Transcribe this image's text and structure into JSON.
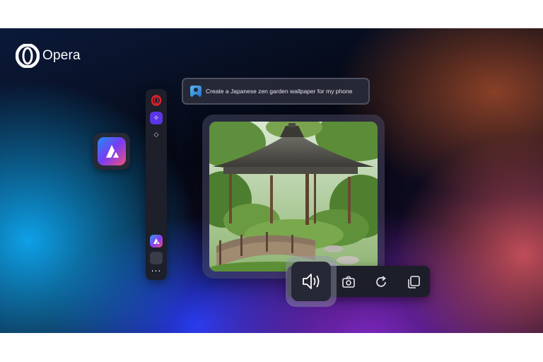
{
  "brand": {
    "name": "Opera"
  },
  "prompt": {
    "text": "Create a Japanese zen garden  wallpaper for my phone"
  },
  "sidebar": {
    "items": [
      "opera-icon",
      "aria-icon",
      "diamond-icon",
      "app-icon",
      "empty-slot",
      "empty-slot"
    ],
    "more_label": "..."
  },
  "toolbar": {
    "buttons": [
      "speaker-icon",
      "camera-icon",
      "refresh-icon",
      "copy-icon"
    ]
  },
  "colors": {
    "accent": "#5b34e6",
    "panel": "#1d1f2b",
    "opera_red": "#e4202c"
  }
}
